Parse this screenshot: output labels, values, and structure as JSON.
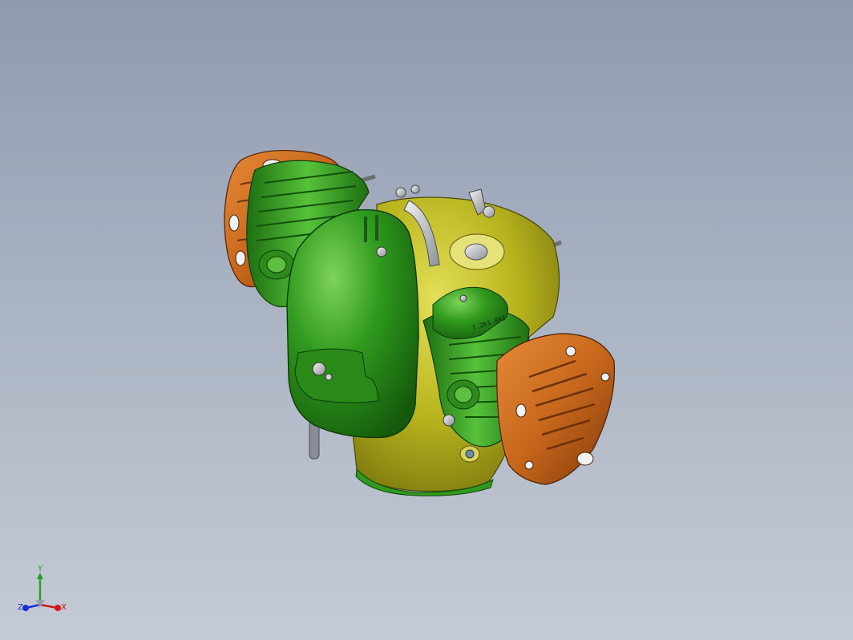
{
  "viewport": {
    "background_top": "#8e9aae",
    "background_bottom": "#c5cbd5"
  },
  "model": {
    "colors": {
      "crankcase": "#b8b41e",
      "crankcase_dark": "#7e7a10",
      "cover_green": "#2f9a1e",
      "cover_green_dark": "#1b6a10",
      "cylinder_green": "#3aa52a",
      "head_orange": "#c8671c",
      "head_orange_dark": "#8a4010",
      "metal": "#b9bcc2"
    },
    "part_number_label": "7.261.003"
  },
  "triad": {
    "y_label": "Y",
    "x_label": "X",
    "z_label": "Z",
    "x_color": "#d01818",
    "y_color": "#1ea81e",
    "z_color": "#1b2fd0"
  }
}
